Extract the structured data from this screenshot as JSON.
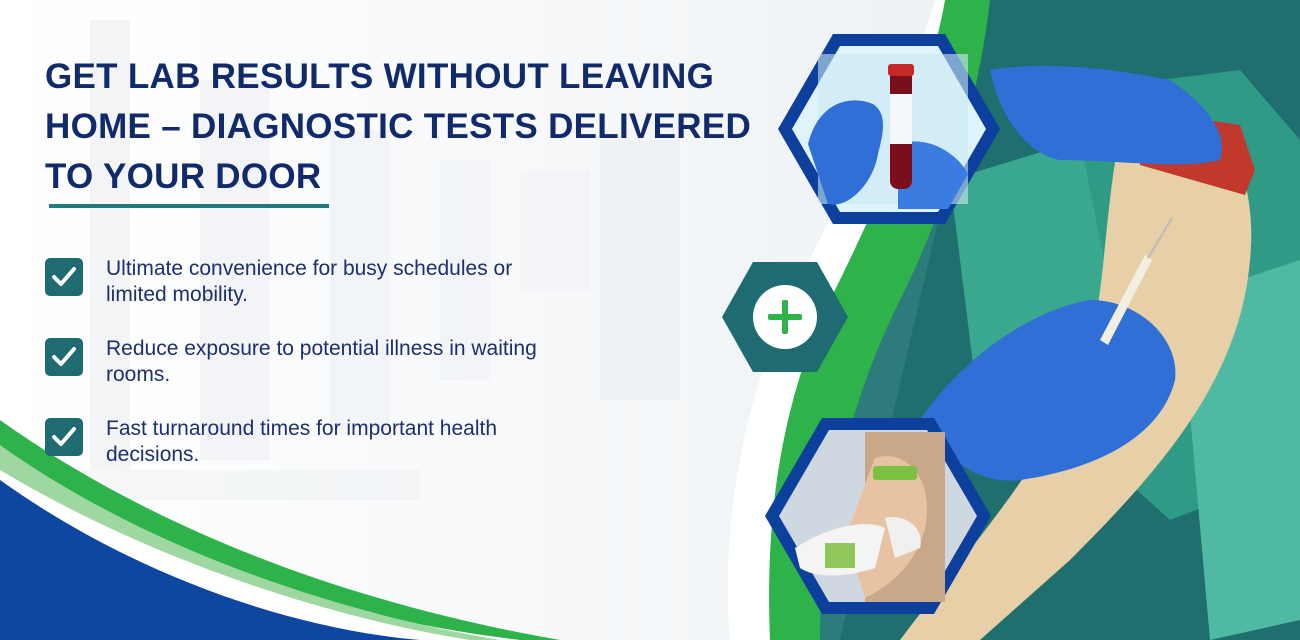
{
  "headline": {
    "line1": "GET LAB RESULTS WITHOUT LEAVING",
    "line2": "HOME – DIAGNOSTIC TESTS DELIVERED",
    "line3": "TO YOUR DOOR"
  },
  "bullets": [
    {
      "text": "Ultimate convenience for busy schedules or limited mobility.",
      "icon": "check-icon"
    },
    {
      "text": "Reduce exposure to potential illness in waiting rooms.",
      "icon": "check-icon"
    },
    {
      "text": "Fast turnaround times for important health decisions.",
      "icon": "check-icon"
    }
  ],
  "icons": {
    "plus": "plus-icon",
    "checkbox": "check-icon"
  },
  "colors": {
    "navy": "#112a6b",
    "teal": "#1f6b72",
    "green": "#2eb34a",
    "blue_frame": "#0d47a1",
    "glove_blue": "#2f6fd6"
  }
}
